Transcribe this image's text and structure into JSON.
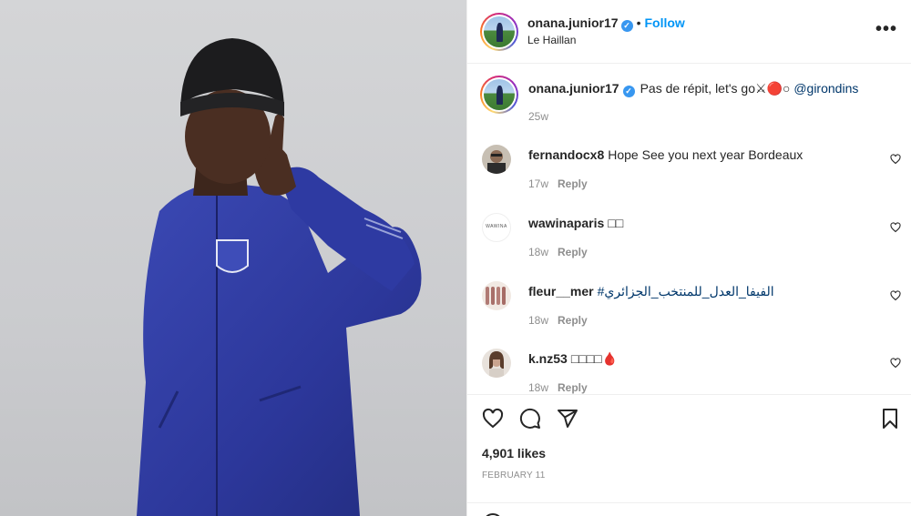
{
  "post": {
    "username": "onana.junior17",
    "verified_mark": "✓",
    "separator": "•",
    "follow_label": "Follow",
    "location": "Le Haillan",
    "more_label": "•••"
  },
  "caption": {
    "username": "onana.junior17",
    "text": "Pas de répit, let's go⚔🔴○",
    "mention": "@girondins",
    "time": "25w"
  },
  "comments": [
    {
      "username": "fernandocx8",
      "text": "Hope See you next year Bordeaux",
      "hashtag": "",
      "time": "17w",
      "reply": "Reply"
    },
    {
      "username": "wawinaparis",
      "text": "□□",
      "hashtag": "",
      "time": "18w",
      "reply": "Reply"
    },
    {
      "username": "fleur__mer",
      "text": "",
      "hashtag": "#الفيفا_العدل_للمنتخب_الجزائري",
      "time": "18w",
      "reply": "Reply"
    },
    {
      "username": "k.nz53",
      "text": "□□□□🩸",
      "hashtag": "",
      "time": "18w",
      "reply": "Reply"
    }
  ],
  "actions": {
    "icons": [
      "heart-icon",
      "comment-icon",
      "share-icon",
      "bookmark-icon"
    ],
    "likes": "4,901 likes",
    "date": "FEBRUARY 11"
  },
  "avatar_logo_text": "WAWINA",
  "colors": {
    "link": "#0095f6",
    "mention": "#00376b",
    "muted": "#8e8e8e",
    "text": "#262626",
    "jacket": "#2f3a9c"
  }
}
